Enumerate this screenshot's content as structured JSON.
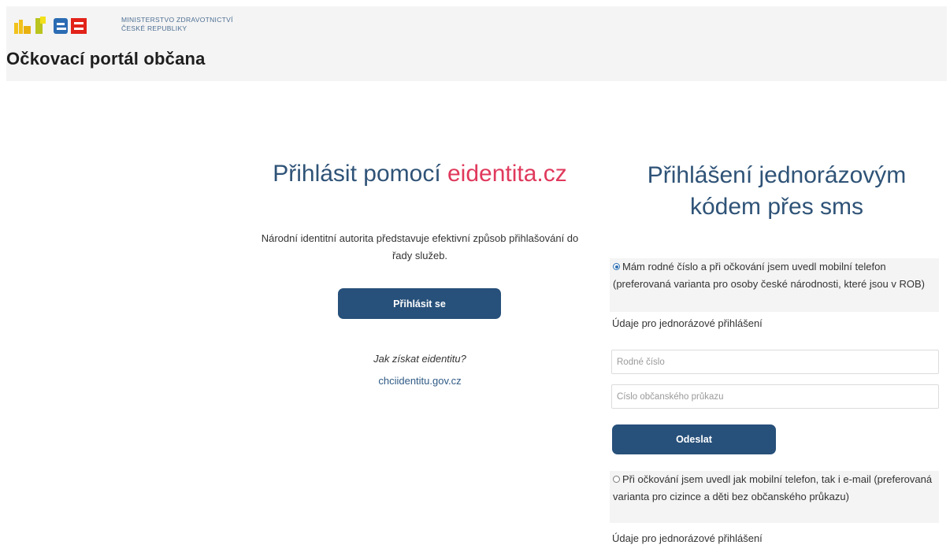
{
  "header": {
    "ministry_line1": "MINISTERSTVO ZDRAVOTNICTVÍ",
    "ministry_line2": "ČESKÉ REPUBLIKY",
    "portal_title": "Očkovací portál občana"
  },
  "left": {
    "title_prefix": "Přihlásit pomocí ",
    "title_brand": "eidentita.cz",
    "description": "Národní identitní autorita představuje efektivní způsob přihlašování do řady služeb.",
    "login_button": "Přihlásit se",
    "how_to_get": "Jak získat eidentitu?",
    "how_to_get_link": "chciidentitu.gov.cz"
  },
  "right": {
    "title": "Přihlášení jednorázovým kódem přes sms",
    "option1": {
      "label": "Mám rodné číslo a při očkování jsem uvedl mobilní telefon (preferovaná varianta pro osoby české národnosti, které jsou v ROB)",
      "selected": true
    },
    "option1_section_label": "Údaje pro jednorázové přihlášení",
    "birth_number_placeholder": "Rodné číslo",
    "id_card_placeholder": "Číslo občanského průkazu",
    "send_button": "Odeslat",
    "option2": {
      "label": "Při očkování jsem uvedl jak mobilní telefon, tak i e-mail (preferovaná varianta pro cizince a děti bez občanského průkazu)",
      "selected": false
    },
    "option2_section_label": "Údaje pro jednorázové přihlášení"
  },
  "colors": {
    "primary_button": "#27507a",
    "title_blue": "#2f5377",
    "brand_pink": "#e0395c",
    "header_bg": "#f4f4f4"
  }
}
